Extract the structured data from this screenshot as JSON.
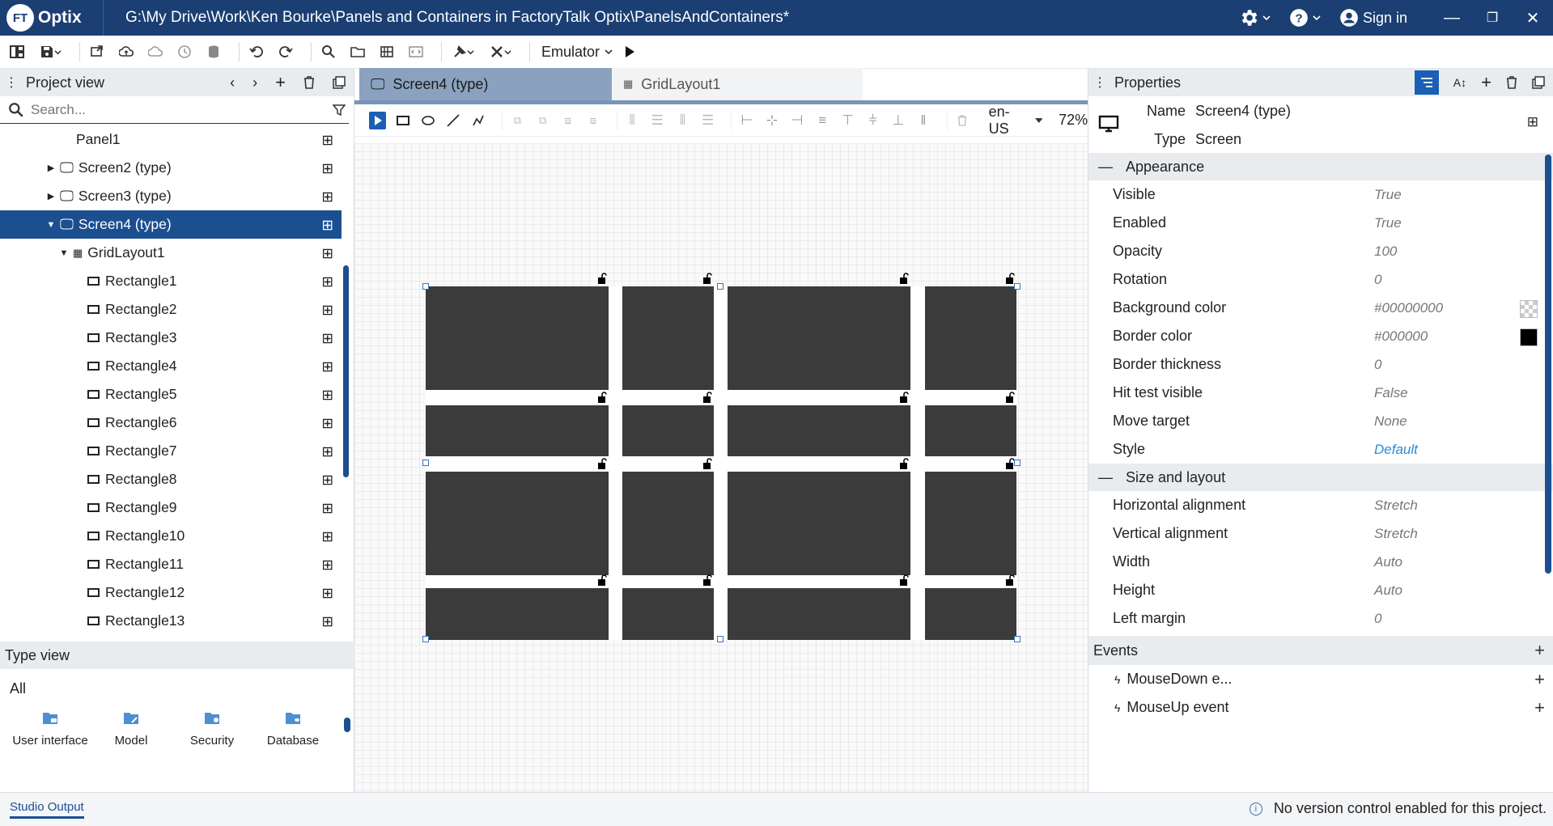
{
  "app": {
    "logo_mark": "FT",
    "logo_name": "Optix",
    "title_path": "G:\\My Drive\\Work\\Ken Bourke\\Panels and Containers in FactoryTalk Optix\\PanelsAndContainers*",
    "sign_in": "Sign in"
  },
  "toolbar": {
    "emulator_label": "Emulator"
  },
  "project_view": {
    "title": "Project view",
    "search_placeholder": "Search...",
    "items": [
      {
        "label": "Panel1"
      },
      {
        "label": "Screen2 (type)"
      },
      {
        "label": "Screen3 (type)"
      },
      {
        "label": "Screen4 (type)"
      },
      {
        "label": "GridLayout1"
      },
      {
        "label": "Rectangle1"
      },
      {
        "label": "Rectangle2"
      },
      {
        "label": "Rectangle3"
      },
      {
        "label": "Rectangle4"
      },
      {
        "label": "Rectangle5"
      },
      {
        "label": "Rectangle6"
      },
      {
        "label": "Rectangle7"
      },
      {
        "label": "Rectangle8"
      },
      {
        "label": "Rectangle9"
      },
      {
        "label": "Rectangle10"
      },
      {
        "label": "Rectangle11"
      },
      {
        "label": "Rectangle12"
      },
      {
        "label": "Rectangle13"
      }
    ]
  },
  "type_view": {
    "title": "Type view",
    "filter": "All",
    "items": [
      {
        "label": "User interface",
        "icon": "user-interface-icon"
      },
      {
        "label": "Model",
        "icon": "model-icon"
      },
      {
        "label": "Security",
        "icon": "security-icon"
      },
      {
        "label": "Database",
        "icon": "database-icon"
      }
    ]
  },
  "editor": {
    "tabs": [
      {
        "label": "Screen4 (type)",
        "active": true
      },
      {
        "label": "GridLayout1",
        "active": false
      }
    ],
    "locale": "en-US",
    "zoom": "72%",
    "grid": {
      "columns": 4,
      "rows": 4,
      "cell_color": "#3b3b3b"
    }
  },
  "properties": {
    "title": "Properties",
    "name_label": "Name",
    "name_value": "Screen4 (type)",
    "type_label": "Type",
    "type_value": "Screen",
    "sections": [
      {
        "title": "Appearance",
        "props": [
          {
            "key": "Visible",
            "value": "True"
          },
          {
            "key": "Enabled",
            "value": "True"
          },
          {
            "key": "Opacity",
            "value": "100"
          },
          {
            "key": "Rotation",
            "value": "0"
          },
          {
            "key": "Background color",
            "value": "#00000000"
          },
          {
            "key": "Border color",
            "value": "#000000"
          },
          {
            "key": "Border thickness",
            "value": "0"
          },
          {
            "key": "Hit test visible",
            "value": "False"
          },
          {
            "key": "Move target",
            "value": "None"
          },
          {
            "key": "Style",
            "value": "Default"
          }
        ]
      },
      {
        "title": "Size and layout",
        "props": [
          {
            "key": "Horizontal alignment",
            "value": "Stretch"
          },
          {
            "key": "Vertical alignment",
            "value": "Stretch"
          },
          {
            "key": "Width",
            "value": "Auto"
          },
          {
            "key": "Height",
            "value": "Auto"
          },
          {
            "key": "Left margin",
            "value": "0"
          }
        ]
      }
    ],
    "events_title": "Events",
    "events": [
      {
        "label": "MouseDown e..."
      },
      {
        "label": "MouseUp event"
      }
    ]
  },
  "status": {
    "output_tab": "Studio Output",
    "version_control": "No version control enabled for this project."
  },
  "colors": {
    "titlebar": "#1b3f73",
    "selection": "#1c4f8f",
    "accent": "#1b5fb4",
    "link": "#2a8ad4"
  }
}
